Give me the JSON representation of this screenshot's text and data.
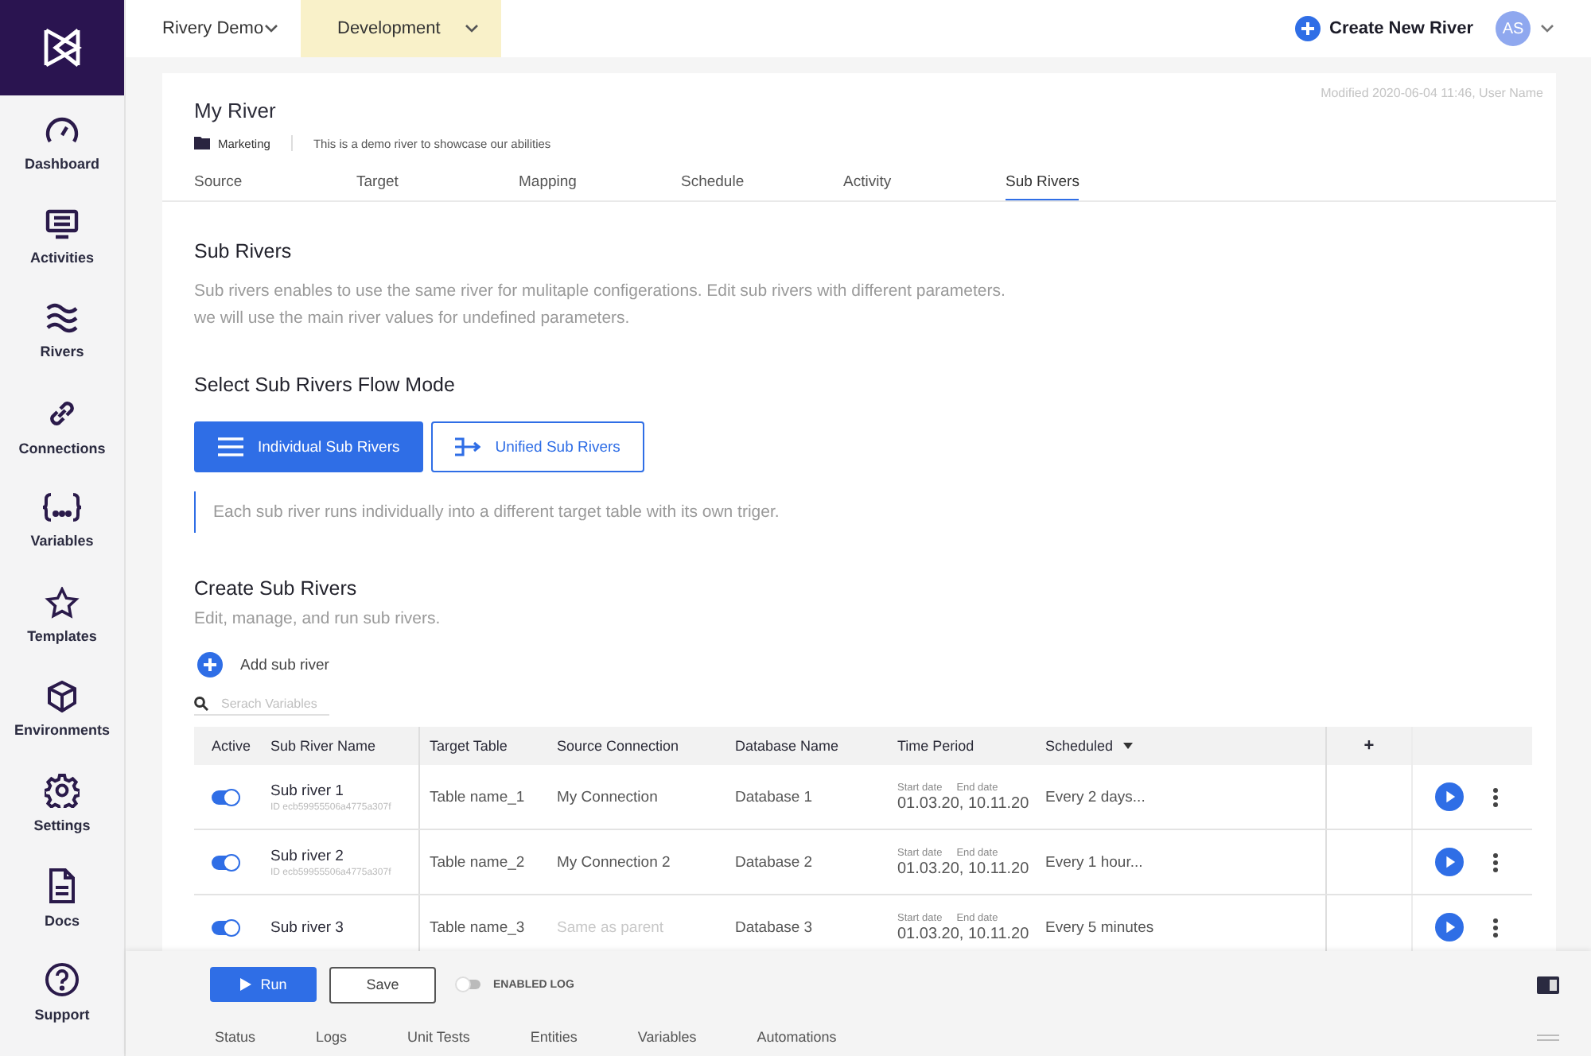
{
  "sidebar": {
    "items": [
      {
        "label": "Dashboard"
      },
      {
        "label": "Activities"
      },
      {
        "label": "Rivers"
      },
      {
        "label": "Connections"
      },
      {
        "label": "Variables"
      },
      {
        "label": "Templates"
      },
      {
        "label": "Environments"
      },
      {
        "label": "Settings"
      },
      {
        "label": "Docs"
      },
      {
        "label": "Support"
      }
    ]
  },
  "topbar": {
    "account": "Rivery Demo",
    "environment": "Development",
    "create_button": "Create New River",
    "avatar": "AS"
  },
  "river": {
    "title": "My River",
    "folder": "Marketing",
    "description": "This is a demo river to showcase our abilities",
    "modified": "Modified 2020-06-04 11:46, User Name"
  },
  "tabs": [
    {
      "label": "Source",
      "selected": false
    },
    {
      "label": "Target",
      "selected": false
    },
    {
      "label": "Mapping",
      "selected": false
    },
    {
      "label": "Schedule",
      "selected": false
    },
    {
      "label": "Activity",
      "selected": false
    },
    {
      "label": "Sub Rivers",
      "selected": true
    }
  ],
  "sub_rivers": {
    "heading": "Sub Rivers",
    "description": "Sub rivers enables to use the same river for mulitaple configerations. Edit sub rivers with different parameters.\nwe will use the main river values for undefined parameters.",
    "flow_heading": "Select Sub Rivers Flow Mode",
    "modes": [
      {
        "label": "Individual Sub Rivers",
        "selected": true
      },
      {
        "label": "Unified Sub Rivers",
        "selected": false
      }
    ],
    "mode_note": "Each sub river runs individually into a different target table with its own triger.",
    "create_heading": "Create Sub Rivers",
    "create_description": "Edit, manage, and run sub rivers.",
    "add_button": "Add sub river",
    "search": {
      "placeholder": "Serach Variables"
    }
  },
  "table": {
    "columns": [
      "Active",
      "Sub River Name",
      "Target Table",
      "Source Connection",
      "Database Name",
      "Time Period",
      "Scheduled",
      "+"
    ],
    "rows": [
      {
        "active": true,
        "name": "Sub river 1",
        "id": "ID ecb59955506a4775a307f",
        "target": "Table name_1",
        "source": "My Connection",
        "inherited": false,
        "database": "Database 1",
        "start_label": "Start date",
        "end_label": "End date",
        "period": "01.03.20, 10.11.20",
        "scheduled": "Every 2 days..."
      },
      {
        "active": true,
        "name": "Sub river 2",
        "id": "ID ecb59955506a4775a307f",
        "target": "Table name_2",
        "source": "My Connection 2",
        "inherited": false,
        "database": "Database 2",
        "start_label": "Start date",
        "end_label": "End date",
        "period": "01.03.20, 10.11.20",
        "scheduled": "Every 1 hour..."
      },
      {
        "active": true,
        "name": "Sub river 3",
        "target": "Table name_3",
        "source": "Same as parent",
        "inherited": true,
        "database": "Database 3",
        "start_label": "Start date",
        "end_label": "End date",
        "period": "01.03.20, 10.11.20",
        "scheduled": "Every 5 minutes"
      }
    ]
  },
  "footer": {
    "run_button": "Run",
    "save_button": "Save",
    "log_toggle": {
      "label": "ENABLED LOG",
      "on": false
    },
    "tabs": [
      {
        "label": "Status"
      },
      {
        "label": "Logs"
      },
      {
        "label": "Unit Tests"
      },
      {
        "label": "Entities"
      },
      {
        "label": "Variables"
      },
      {
        "label": "Automations"
      }
    ]
  }
}
